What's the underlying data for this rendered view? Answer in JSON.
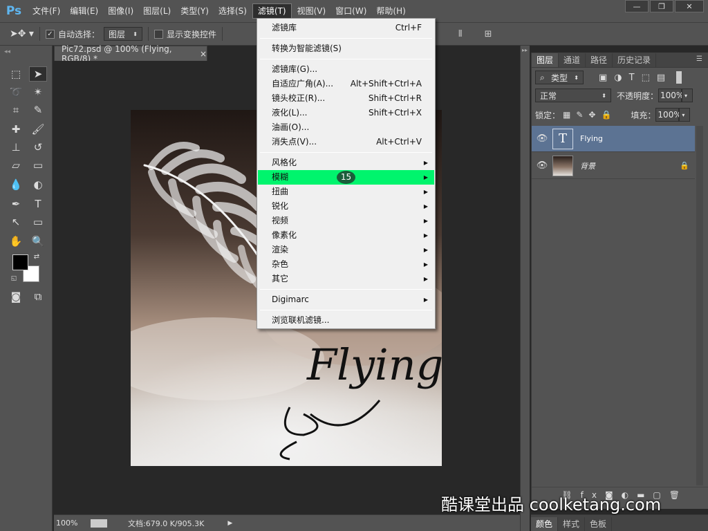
{
  "app": {
    "logo": "Ps"
  },
  "menubar": {
    "items": [
      "文件(F)",
      "编辑(E)",
      "图像(I)",
      "图层(L)",
      "类型(Y)",
      "选择(S)",
      "滤镜(T)",
      "视图(V)",
      "窗口(W)",
      "帮助(H)"
    ],
    "active_index": 6
  },
  "window_controls": {
    "minimize": "—",
    "restore": "❐",
    "close": "✕"
  },
  "optionsbar": {
    "auto_select_label": "自动选择：",
    "auto_select_checked": true,
    "layer_dropdown": "图层",
    "show_transform_label": "显示变换控件"
  },
  "document": {
    "tab_title": "Pic72.psd @ 100% (Flying, RGB/8) *",
    "tab_close": "×",
    "canvas_text": "Flying"
  },
  "status": {
    "zoom": "100%",
    "doc_info": "文档:679.0 K/905.3K"
  },
  "layers_panel": {
    "tabs": [
      "图层",
      "通道",
      "路径",
      "历史记录"
    ],
    "active_tab": 0,
    "filter_kind": "类型",
    "blend_mode": "正常",
    "opacity_label": "不透明度：",
    "opacity_value": "100%",
    "lock_label": "锁定：",
    "fill_label": "填充：",
    "fill_value": "100%",
    "layers": [
      {
        "name": "Flying",
        "type": "text",
        "selected": true
      },
      {
        "name": "背景",
        "type": "image",
        "selected": false,
        "locked": true
      }
    ]
  },
  "bottom_panel": {
    "tabs": [
      "颜色",
      "样式",
      "色板"
    ]
  },
  "filter_menu": {
    "items": [
      {
        "label": "滤镜库",
        "shortcut": "Ctrl+F"
      },
      {
        "label": "转换为智能滤镜(S)"
      },
      {
        "label": "滤镜库(G)..."
      },
      {
        "label": "自适应广角(A)...",
        "shortcut": "Alt+Shift+Ctrl+A"
      },
      {
        "label": "镜头校正(R)...",
        "shortcut": "Shift+Ctrl+R"
      },
      {
        "label": "液化(L)...",
        "shortcut": "Shift+Ctrl+X"
      },
      {
        "label": "油画(O)..."
      },
      {
        "label": "消失点(V)...",
        "shortcut": "Alt+Ctrl+V"
      },
      {
        "label": "风格化",
        "submenu": true
      },
      {
        "label": "模糊",
        "submenu": true,
        "highlighted": true
      },
      {
        "label": "扭曲",
        "submenu": true
      },
      {
        "label": "锐化",
        "submenu": true
      },
      {
        "label": "视频",
        "submenu": true
      },
      {
        "label": "像素化",
        "submenu": true
      },
      {
        "label": "渲染",
        "submenu": true
      },
      {
        "label": "杂色",
        "submenu": true
      },
      {
        "label": "其它",
        "submenu": true
      },
      {
        "label": "Digimarc",
        "submenu": true
      },
      {
        "label": "浏览联机滤镜..."
      }
    ],
    "step_badge": "15"
  },
  "watermark": "酷课堂出品 coolketang.com",
  "colors": {
    "highlight": "#00f46d",
    "selected_layer": "#5c7393",
    "panel_bg": "#535353"
  }
}
